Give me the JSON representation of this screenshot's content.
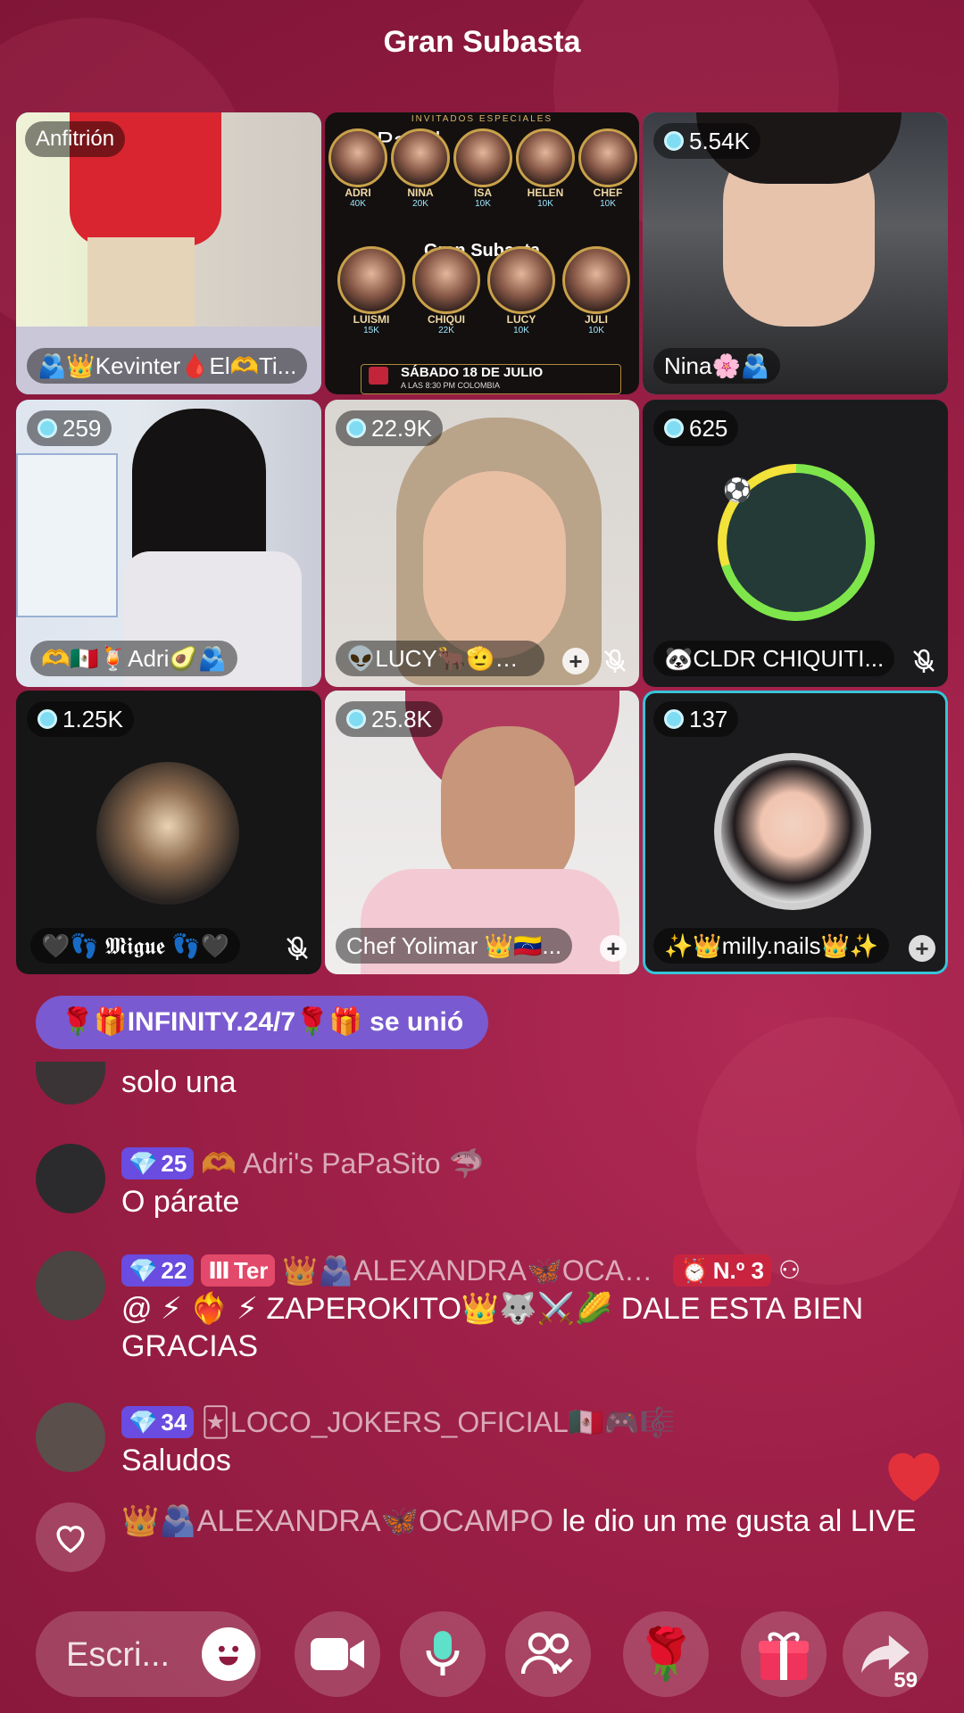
{
  "title": "Gran Subasta",
  "tiles": [
    {
      "label": "Anfitrión",
      "name": "🫂👑Kevinter🩸El🫶Ti..."
    },
    {
      "panel_label": "Panel",
      "poster": {
        "header": "INVITADOS ESPECIALES",
        "center": "Gran Subasta",
        "row1": [
          {
            "n": "ADRI",
            "v": "40K"
          },
          {
            "n": "NINA",
            "v": "20K"
          },
          {
            "n": "ISA",
            "v": "10K"
          },
          {
            "n": "HELEN",
            "v": "10K"
          },
          {
            "n": "CHEF",
            "v": "10K"
          }
        ],
        "row2": [
          {
            "n": "LUISMI",
            "v": "15K"
          },
          {
            "n": "CHIQUI",
            "v": "22K"
          },
          {
            "n": "LUCY",
            "v": "10K"
          },
          {
            "n": "JULI",
            "v": "10K"
          }
        ],
        "date": "SÁBADO 18 DE JULIO",
        "time": "A LAS 8:30 PM COLOMBIA"
      }
    },
    {
      "count": "5.54K",
      "name": "Nina🌸🫂"
    },
    {
      "count": "259",
      "name": "🫶🇲🇽🍹Adri🥑🫂"
    },
    {
      "count": "22.9K",
      "name": "👽LUCY🐂🫡🦔🐱"
    },
    {
      "count": "625",
      "name": "🐼CLDR CHIQUITI..."
    },
    {
      "count": "1.25K",
      "name": "🖤👣 𝕸𝖎𝖌𝖚𝖊 👣🖤"
    },
    {
      "count": "25.8K",
      "name": "Chef Yolimar 👑🇻🇪..."
    },
    {
      "count": "137",
      "name": "✨👑milly.nails👑✨"
    }
  ],
  "join_banner": "🌹🎁INFINITY.24/7🌹🎁 se unió",
  "messages": [
    {
      "text": "solo una"
    },
    {
      "level": "25",
      "user": "🫶 Adri's PaPaSito 🦈",
      "text": "O párate"
    },
    {
      "level": "22",
      "ter": "Ter",
      "user": "👑🫂ALEXANDRA🦋OCAM...",
      "no": "N.º 3",
      "text": "@ ⚡ ❤️‍🔥 ⚡ ZAPEROKITO👑🐺⚔️🌽 DALE ESTA BIEN GRACIAS"
    },
    {
      "level": "34",
      "user": "🃏LOCO_JOKERS_OFICIAL🇲🇽🎮🎼",
      "text": "Saludos"
    },
    {
      "user": "👑🫂ALEXANDRA🦋OCAMPO",
      "text": "le dio un me gusta al LIVE"
    }
  ],
  "input_placeholder": "Escri...",
  "share_count": "59"
}
